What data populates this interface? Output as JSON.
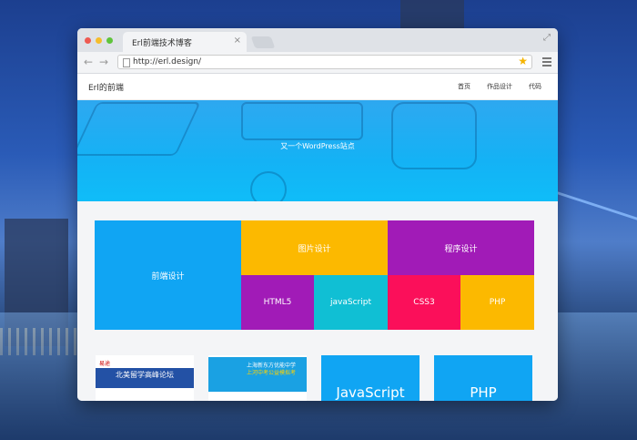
{
  "browser": {
    "tab_title": "Erl前端技术博客",
    "tab_close": "×",
    "expand_symbol": "⤢",
    "url": "http://erl.design/",
    "back_symbol": "←",
    "forward_symbol": "→",
    "star_symbol": "★"
  },
  "site": {
    "title": "Erl的前端",
    "nav": [
      "首页",
      "作品设计",
      "代码"
    ],
    "hero_tagline": "又一个WordPress站点"
  },
  "categories": {
    "frontend": "前端设计",
    "image_design": "图片设计",
    "program_design": "程序设计",
    "html5": "HTML5",
    "javascript": "javaScript",
    "css3": "CSS3",
    "php": "PHP"
  },
  "cards": {
    "card1_top": "易途",
    "card1_banner": "北美留学高峰论坛",
    "card2_line1": "上海新东方优能中学",
    "card2_line2": "上河中考公益模拟考",
    "card3_label": "JavaScript",
    "card4_label": "PHP"
  },
  "colors": {
    "blue": "#10a5f3",
    "yellow": "#fcb900",
    "purple": "#a11bb7",
    "teal": "#10bfd4",
    "pink": "#fb0f5a"
  }
}
